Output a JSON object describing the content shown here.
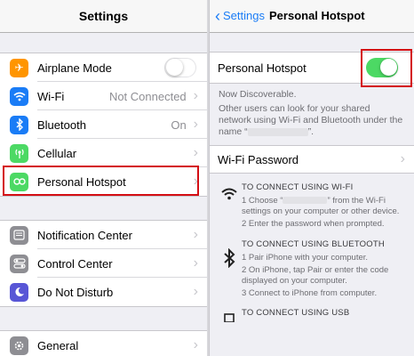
{
  "left": {
    "title": "Settings",
    "group1": [
      {
        "label": "Airplane Mode",
        "icon": "airplane-icon",
        "color": "#ff9500",
        "control": "switch-off"
      },
      {
        "label": "Wi-Fi",
        "icon": "wifi-icon",
        "color": "#1a7cf6",
        "value": "Not Connected"
      },
      {
        "label": "Bluetooth",
        "icon": "bluetooth-icon",
        "color": "#1a7cf6",
        "value": "On"
      },
      {
        "label": "Cellular",
        "icon": "cellular-icon",
        "color": "#4cd964",
        "value": ""
      },
      {
        "label": "Personal Hotspot",
        "icon": "hotspot-icon",
        "color": "#4cd964",
        "value": ""
      }
    ],
    "group2": [
      {
        "label": "Notification Center",
        "icon": "notification-center-icon",
        "color": "#8e8e93"
      },
      {
        "label": "Control Center",
        "icon": "control-center-icon",
        "color": "#8e8e93"
      },
      {
        "label": "Do Not Disturb",
        "icon": "do-not-disturb-icon",
        "color": "#5856d6"
      }
    ],
    "group3": [
      {
        "label": "General",
        "icon": "gear-icon",
        "color": "#8e8e93"
      }
    ]
  },
  "right": {
    "back_label": "Settings",
    "title": "Personal Hotspot",
    "hotspot_label": "Personal Hotspot",
    "hotspot_on": true,
    "discoverable": "Now Discoverable.",
    "share_text": "Other users can look for your shared network using Wi-Fi and Bluetooth under the name “",
    "share_text_end": "”.",
    "wifi_password_label": "Wi-Fi Password",
    "wifi_head": "TO CONNECT USING WI-FI",
    "wifi_step1": "1 Choose “",
    "wifi_step1_end": "” from the Wi-Fi settings on your computer or other device.",
    "wifi_step2": "2 Enter the password when prompted.",
    "bt_head": "TO CONNECT USING BLUETOOTH",
    "bt_step1": "1 Pair iPhone with your computer.",
    "bt_step2": "2 On iPhone, tap Pair or enter the code displayed on your computer.",
    "bt_step3": "3 Connect to iPhone from computer.",
    "usb_head": "TO CONNECT USING USB"
  },
  "colors": {
    "accent": "#1a7cf6",
    "switch_on": "#4cd964",
    "highlight": "#d40e14"
  }
}
